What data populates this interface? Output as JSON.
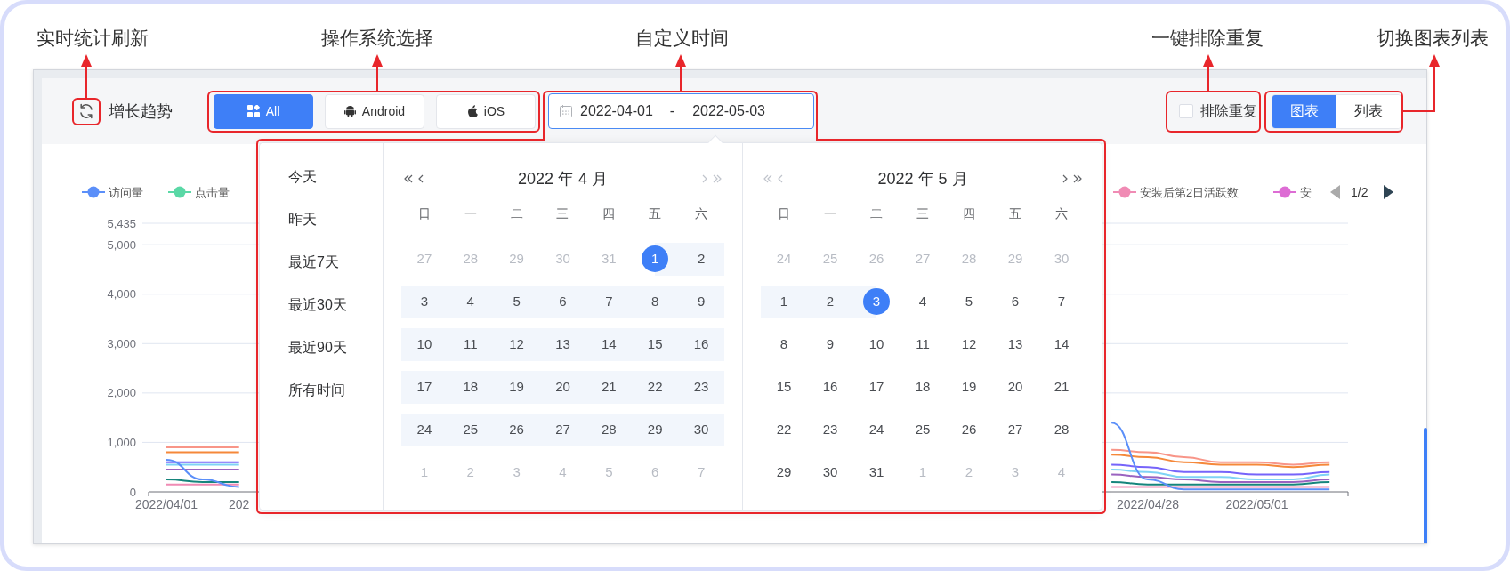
{
  "annotations": [
    {
      "label": "实时统计刷新"
    },
    {
      "label": "操作系统选择"
    },
    {
      "label": "自定义时间"
    },
    {
      "label": "一键排除重复"
    },
    {
      "label": "切换图表列表"
    }
  ],
  "toolbar": {
    "title": "增长趋势",
    "os_buttons": [
      {
        "label": "All",
        "kind": "all",
        "selected": true
      },
      {
        "label": "Android",
        "kind": "android",
        "selected": false
      },
      {
        "label": "iOS",
        "kind": "ios",
        "selected": false
      }
    ],
    "date_range": {
      "start": "2022-04-01",
      "separator": "-",
      "end": "2022-05-03",
      "focused": true
    },
    "exclude_duplicates": {
      "label": "排除重复",
      "checked": false
    },
    "view_toggle": [
      {
        "label": "图表",
        "selected": true
      },
      {
        "label": "列表",
        "selected": false
      }
    ]
  },
  "chart": {
    "legend": [
      {
        "label": "访问量",
        "color": "#5b8ff9"
      },
      {
        "label": "点击量",
        "color": "#5ad8a6"
      },
      {
        "label": "安装后第2日活跃数",
        "color": "#f08bb4"
      },
      {
        "label": "安",
        "color": "#dd6cd4"
      }
    ],
    "legend_pager": {
      "text": "1/2",
      "prev_disabled": true,
      "next_disabled": false
    },
    "chart_data": {
      "type": "line",
      "ylim": [
        0,
        5435
      ],
      "grid": true,
      "categories": [
        "2022/04/01",
        null,
        "202",
        null,
        null,
        null,
        null,
        null,
        null,
        null,
        null,
        null,
        null,
        null,
        null,
        null,
        null,
        null,
        null,
        null,
        null,
        null,
        null,
        null,
        null,
        null,
        null,
        "2022/04/28",
        null,
        null,
        "2022/05/01",
        null,
        null
      ],
      "yticks": [
        {
          "value": 5435,
          "label": "5,435"
        },
        {
          "value": 5000,
          "label": "5,000"
        },
        {
          "value": 4000,
          "label": "4,000"
        },
        {
          "value": 3000,
          "label": "3,000"
        },
        {
          "value": 2000,
          "label": "2,000"
        },
        {
          "value": 1000,
          "label": "1,000"
        },
        {
          "value": 0,
          "label": "0"
        }
      ],
      "series": [
        {
          "color": "#f89588",
          "values": [
            900,
            900,
            900,
            null,
            null,
            null,
            null,
            null,
            null,
            null,
            null,
            null,
            null,
            null,
            null,
            null,
            null,
            null,
            null,
            null,
            null,
            null,
            null,
            null,
            null,
            null,
            850,
            800,
            700,
            600,
            600,
            550,
            600
          ]
        },
        {
          "color": "#f5883a",
          "values": [
            800,
            800,
            800,
            null,
            null,
            null,
            null,
            null,
            null,
            null,
            null,
            null,
            null,
            null,
            null,
            null,
            null,
            null,
            null,
            null,
            null,
            null,
            null,
            null,
            null,
            null,
            750,
            700,
            600,
            550,
            550,
            500,
            550
          ]
        },
        {
          "color": "#7664fa",
          "values": [
            600,
            600,
            600,
            null,
            null,
            null,
            null,
            null,
            null,
            null,
            null,
            null,
            null,
            null,
            null,
            null,
            null,
            null,
            null,
            null,
            null,
            null,
            null,
            null,
            null,
            null,
            550,
            500,
            400,
            400,
            350,
            350,
            400
          ]
        },
        {
          "color": "#7fd3f5",
          "values": [
            550,
            550,
            550,
            null,
            null,
            null,
            null,
            null,
            null,
            null,
            null,
            null,
            null,
            null,
            null,
            null,
            null,
            null,
            null,
            null,
            null,
            null,
            null,
            null,
            null,
            null,
            450,
            400,
            300,
            300,
            250,
            250,
            350
          ]
        },
        {
          "color": "#9a63c0",
          "values": [
            450,
            450,
            450,
            null,
            null,
            null,
            null,
            null,
            null,
            null,
            null,
            null,
            null,
            null,
            null,
            null,
            null,
            null,
            null,
            null,
            null,
            null,
            null,
            null,
            null,
            null,
            350,
            300,
            250,
            200,
            200,
            200,
            250
          ]
        },
        {
          "color": "#16857c",
          "values": [
            250,
            200,
            200,
            null,
            null,
            null,
            null,
            null,
            null,
            null,
            null,
            null,
            null,
            null,
            null,
            null,
            null,
            null,
            null,
            null,
            null,
            null,
            null,
            null,
            null,
            null,
            200,
            150,
            150,
            150,
            150,
            150,
            200
          ]
        },
        {
          "color": "#f08bb4",
          "values": [
            150,
            150,
            150,
            null,
            null,
            null,
            null,
            null,
            null,
            null,
            null,
            null,
            null,
            null,
            null,
            null,
            null,
            null,
            null,
            null,
            null,
            null,
            null,
            null,
            null,
            null,
            100,
            100,
            100,
            100,
            100,
            100,
            100
          ]
        },
        {
          "color": "#5b8ff9",
          "values": [
            650,
            250,
            100,
            null,
            null,
            null,
            null,
            null,
            null,
            null,
            null,
            null,
            null,
            null,
            null,
            null,
            null,
            null,
            null,
            null,
            null,
            null,
            null,
            null,
            null,
            null,
            1400,
            250,
            50,
            50,
            50,
            50,
            50
          ]
        }
      ]
    }
  },
  "date_picker": {
    "shortcuts": [
      "今天",
      "昨天",
      "最近7天",
      "最近30天",
      "最近90天",
      "所有时间"
    ],
    "panels": [
      {
        "title": "2022 年 4 月",
        "prev_disabled": false,
        "next_disabled": true,
        "weekdays": [
          "日",
          "一",
          "二",
          "三",
          "四",
          "五",
          "六"
        ],
        "weeks": [
          [
            {
              "day": "27",
              "other_month": true,
              "in_range": false,
              "selected": false
            },
            {
              "day": "28",
              "other_month": true,
              "in_range": false,
              "selected": false
            },
            {
              "day": "29",
              "other_month": true,
              "in_range": false,
              "selected": false
            },
            {
              "day": "30",
              "other_month": true,
              "in_range": false,
              "selected": false
            },
            {
              "day": "31",
              "other_month": true,
              "in_range": false,
              "selected": false
            },
            {
              "day": "1",
              "other_month": false,
              "in_range": false,
              "selected": true
            },
            {
              "day": "2",
              "other_month": false,
              "in_range": true,
              "selected": false
            }
          ],
          [
            {
              "day": "3",
              "other_month": false,
              "in_range": true,
              "selected": false
            },
            {
              "day": "4",
              "other_month": false,
              "in_range": true,
              "selected": false
            },
            {
              "day": "5",
              "other_month": false,
              "in_range": true,
              "selected": false
            },
            {
              "day": "6",
              "other_month": false,
              "in_range": true,
              "selected": false
            },
            {
              "day": "7",
              "other_month": false,
              "in_range": true,
              "selected": false
            },
            {
              "day": "8",
              "other_month": false,
              "in_range": true,
              "selected": false
            },
            {
              "day": "9",
              "other_month": false,
              "in_range": true,
              "selected": false
            }
          ],
          [
            {
              "day": "10",
              "other_month": false,
              "in_range": true,
              "selected": false
            },
            {
              "day": "11",
              "other_month": false,
              "in_range": true,
              "selected": false
            },
            {
              "day": "12",
              "other_month": false,
              "in_range": true,
              "selected": false
            },
            {
              "day": "13",
              "other_month": false,
              "in_range": true,
              "selected": false
            },
            {
              "day": "14",
              "other_month": false,
              "in_range": true,
              "selected": false
            },
            {
              "day": "15",
              "other_month": false,
              "in_range": true,
              "selected": false
            },
            {
              "day": "16",
              "other_month": false,
              "in_range": true,
              "selected": false
            }
          ],
          [
            {
              "day": "17",
              "other_month": false,
              "in_range": true,
              "selected": false
            },
            {
              "day": "18",
              "other_month": false,
              "in_range": true,
              "selected": false
            },
            {
              "day": "19",
              "other_month": false,
              "in_range": true,
              "selected": false
            },
            {
              "day": "20",
              "other_month": false,
              "in_range": true,
              "selected": false
            },
            {
              "day": "21",
              "other_month": false,
              "in_range": true,
              "selected": false
            },
            {
              "day": "22",
              "other_month": false,
              "in_range": true,
              "selected": false
            },
            {
              "day": "23",
              "other_month": false,
              "in_range": true,
              "selected": false
            }
          ],
          [
            {
              "day": "24",
              "other_month": false,
              "in_range": true,
              "selected": false
            },
            {
              "day": "25",
              "other_month": false,
              "in_range": true,
              "selected": false
            },
            {
              "day": "26",
              "other_month": false,
              "in_range": true,
              "selected": false
            },
            {
              "day": "27",
              "other_month": false,
              "in_range": true,
              "selected": false
            },
            {
              "day": "28",
              "other_month": false,
              "in_range": true,
              "selected": false
            },
            {
              "day": "29",
              "other_month": false,
              "in_range": true,
              "selected": false
            },
            {
              "day": "30",
              "other_month": false,
              "in_range": true,
              "selected": false
            }
          ],
          [
            {
              "day": "1",
              "other_month": true,
              "in_range": false,
              "selected": false
            },
            {
              "day": "2",
              "other_month": true,
              "in_range": false,
              "selected": false
            },
            {
              "day": "3",
              "other_month": true,
              "in_range": false,
              "selected": false
            },
            {
              "day": "4",
              "other_month": true,
              "in_range": false,
              "selected": false
            },
            {
              "day": "5",
              "other_month": true,
              "in_range": false,
              "selected": false
            },
            {
              "day": "6",
              "other_month": true,
              "in_range": false,
              "selected": false
            },
            {
              "day": "7",
              "other_month": true,
              "in_range": false,
              "selected": false
            }
          ]
        ]
      },
      {
        "title": "2022 年 5 月",
        "prev_disabled": true,
        "next_disabled": false,
        "weekdays": [
          "日",
          "一",
          "二",
          "三",
          "四",
          "五",
          "六"
        ],
        "weeks": [
          [
            {
              "day": "24",
              "other_month": true,
              "in_range": false,
              "selected": false
            },
            {
              "day": "25",
              "other_month": true,
              "in_range": false,
              "selected": false
            },
            {
              "day": "26",
              "other_month": true,
              "in_range": false,
              "selected": false
            },
            {
              "day": "27",
              "other_month": true,
              "in_range": false,
              "selected": false
            },
            {
              "day": "28",
              "other_month": true,
              "in_range": false,
              "selected": false
            },
            {
              "day": "29",
              "other_month": true,
              "in_range": false,
              "selected": false
            },
            {
              "day": "30",
              "other_month": true,
              "in_range": false,
              "selected": false
            }
          ],
          [
            {
              "day": "1",
              "other_month": false,
              "in_range": true,
              "selected": false
            },
            {
              "day": "2",
              "other_month": false,
              "in_range": true,
              "selected": false
            },
            {
              "day": "3",
              "other_month": false,
              "in_range": false,
              "selected": true
            },
            {
              "day": "4",
              "other_month": false,
              "in_range": false,
              "selected": false
            },
            {
              "day": "5",
              "other_month": false,
              "in_range": false,
              "selected": false
            },
            {
              "day": "6",
              "other_month": false,
              "in_range": false,
              "selected": false
            },
            {
              "day": "7",
              "other_month": false,
              "in_range": false,
              "selected": false
            }
          ],
          [
            {
              "day": "8",
              "other_month": false,
              "in_range": false,
              "selected": false
            },
            {
              "day": "9",
              "other_month": false,
              "in_range": false,
              "selected": false
            },
            {
              "day": "10",
              "other_month": false,
              "in_range": false,
              "selected": false
            },
            {
              "day": "11",
              "other_month": false,
              "in_range": false,
              "selected": false
            },
            {
              "day": "12",
              "other_month": false,
              "in_range": false,
              "selected": false
            },
            {
              "day": "13",
              "other_month": false,
              "in_range": false,
              "selected": false
            },
            {
              "day": "14",
              "other_month": false,
              "in_range": false,
              "selected": false
            }
          ],
          [
            {
              "day": "15",
              "other_month": false,
              "in_range": false,
              "selected": false
            },
            {
              "day": "16",
              "other_month": false,
              "in_range": false,
              "selected": false
            },
            {
              "day": "17",
              "other_month": false,
              "in_range": false,
              "selected": false
            },
            {
              "day": "18",
              "other_month": false,
              "in_range": false,
              "selected": false
            },
            {
              "day": "19",
              "other_month": false,
              "in_range": false,
              "selected": false
            },
            {
              "day": "20",
              "other_month": false,
              "in_range": false,
              "selected": false
            },
            {
              "day": "21",
              "other_month": false,
              "in_range": false,
              "selected": false
            }
          ],
          [
            {
              "day": "22",
              "other_month": false,
              "in_range": false,
              "selected": false
            },
            {
              "day": "23",
              "other_month": false,
              "in_range": false,
              "selected": false
            },
            {
              "day": "24",
              "other_month": false,
              "in_range": false,
              "selected": false
            },
            {
              "day": "25",
              "other_month": false,
              "in_range": false,
              "selected": false
            },
            {
              "day": "26",
              "other_month": false,
              "in_range": false,
              "selected": false
            },
            {
              "day": "27",
              "other_month": false,
              "in_range": false,
              "selected": false
            },
            {
              "day": "28",
              "other_month": false,
              "in_range": false,
              "selected": false
            }
          ],
          [
            {
              "day": "29",
              "other_month": false,
              "in_range": false,
              "selected": false
            },
            {
              "day": "30",
              "other_month": false,
              "in_range": false,
              "selected": false
            },
            {
              "day": "31",
              "other_month": false,
              "in_range": false,
              "selected": false
            },
            {
              "day": "1",
              "other_month": true,
              "in_range": false,
              "selected": false
            },
            {
              "day": "2",
              "other_month": true,
              "in_range": false,
              "selected": false
            },
            {
              "day": "3",
              "other_month": true,
              "in_range": false,
              "selected": false
            },
            {
              "day": "4",
              "other_month": true,
              "in_range": false,
              "selected": false
            }
          ]
        ]
      }
    ]
  }
}
